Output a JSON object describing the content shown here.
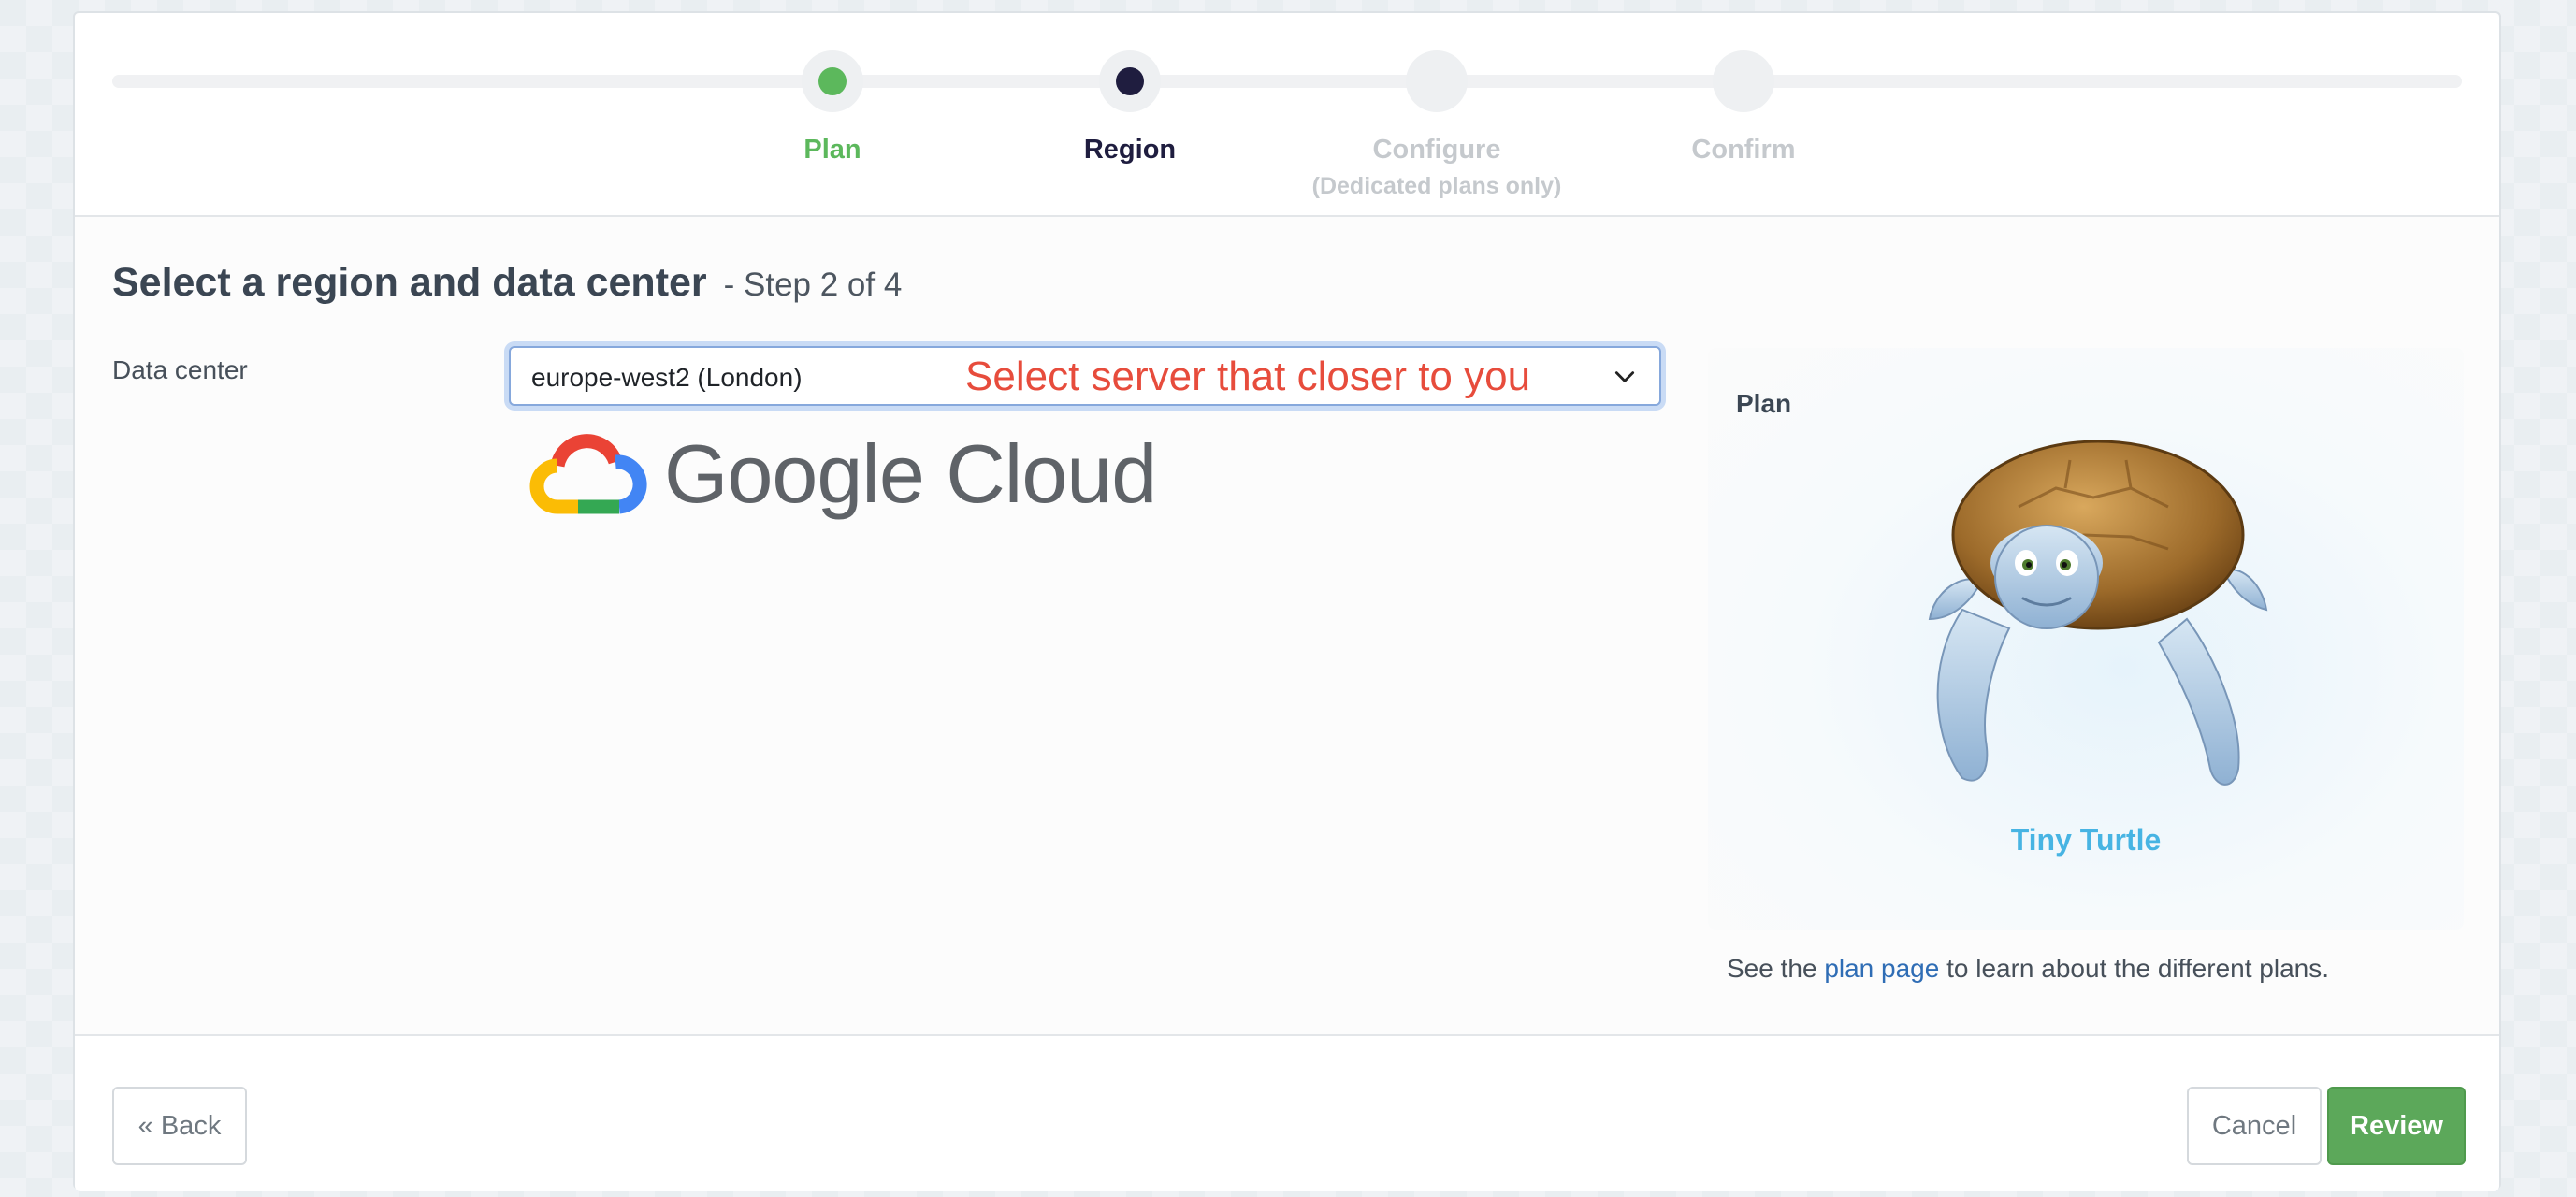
{
  "stepper": {
    "steps": [
      {
        "label": "Plan",
        "sublabel": "",
        "state": "complete",
        "color": "#5cb85c"
      },
      {
        "label": "Region",
        "sublabel": "",
        "state": "current",
        "color": "#1f1d3f"
      },
      {
        "label": "Configure",
        "sublabel": "(Dedicated plans only)",
        "state": "upcoming",
        "color": "#c5c9cd"
      },
      {
        "label": "Confirm",
        "sublabel": "",
        "state": "upcoming",
        "color": "#c5c9cd"
      }
    ]
  },
  "page": {
    "title": "Select a region and data center",
    "step_text": "- Step 2 of 4"
  },
  "form": {
    "data_center_label": "Data center",
    "data_center_value": "europe-west2 (London)",
    "annotation": "Select server that closer to you"
  },
  "provider": {
    "logo_text": "Google Cloud",
    "logo_colors": [
      "#ea4335",
      "#4285f4",
      "#34a853",
      "#fbbc05"
    ]
  },
  "plan": {
    "title": "Plan",
    "name": "Tiny Turtle",
    "note_before": "See the ",
    "note_link": "plan page",
    "note_after": " to learn about the different plans."
  },
  "footer": {
    "back_label": "« Back",
    "cancel_label": "Cancel",
    "review_label": "Review"
  },
  "colors": {
    "accent_green": "#5ca85a",
    "link_blue": "#2f6db5",
    "plan_name": "#47b4e3",
    "annotation_red": "#e74c3c"
  }
}
